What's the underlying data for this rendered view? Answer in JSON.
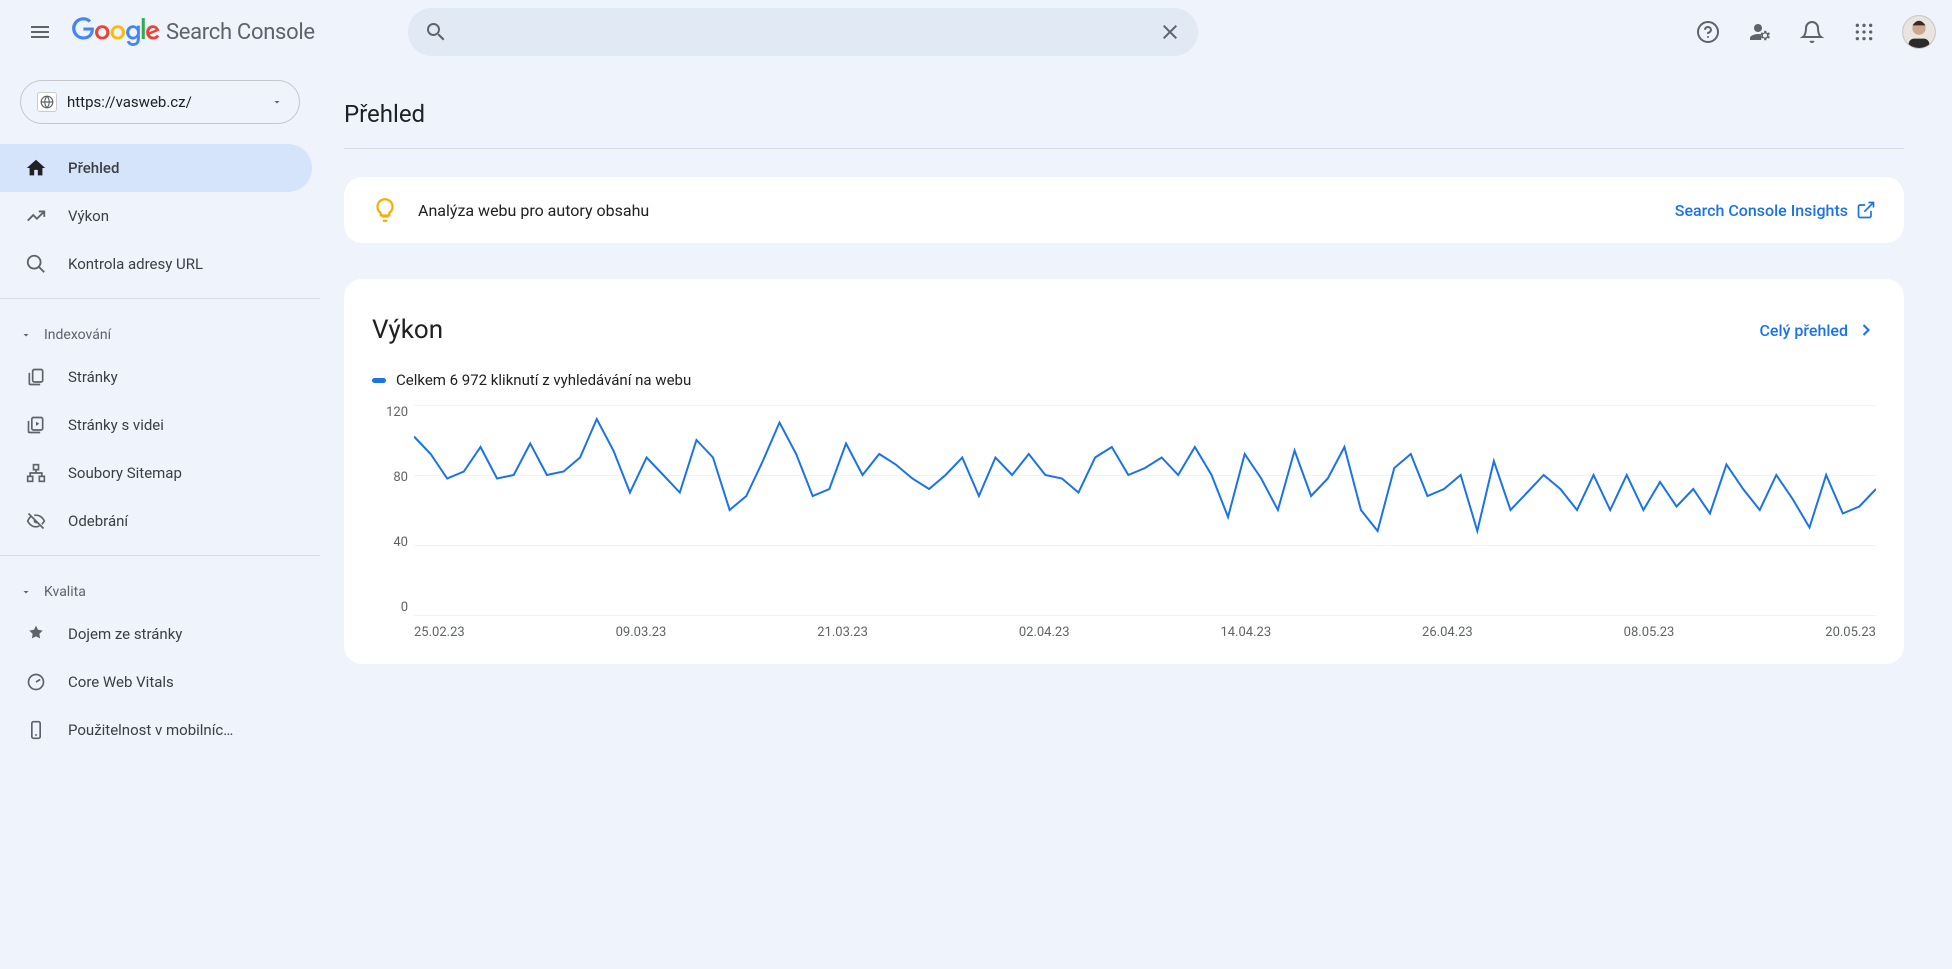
{
  "app_name": "Search Console",
  "header": {
    "search_placeholder": ""
  },
  "property": {
    "url": "https://vasweb.cz/"
  },
  "sidebar": {
    "primary": [
      {
        "id": "overview",
        "label": "Přehled"
      },
      {
        "id": "performance",
        "label": "Výkon"
      },
      {
        "id": "urlinspect",
        "label": "Kontrola adresy URL"
      }
    ],
    "sections": [
      {
        "id": "indexing",
        "label": "Indexování",
        "items": [
          {
            "id": "pages",
            "label": "Stránky"
          },
          {
            "id": "video-pages",
            "label": "Stránky s videi"
          },
          {
            "id": "sitemaps",
            "label": "Soubory Sitemap"
          },
          {
            "id": "removals",
            "label": "Odebrání"
          }
        ]
      },
      {
        "id": "quality",
        "label": "Kvalita",
        "items": [
          {
            "id": "page-experience",
            "label": "Dojem ze stránky"
          },
          {
            "id": "cwv",
            "label": "Core Web Vitals"
          },
          {
            "id": "mobile",
            "label": "Použitelnost v mobilníc…"
          }
        ]
      }
    ]
  },
  "page": {
    "title": "Přehled"
  },
  "insights_card": {
    "text": "Analýza webu pro autory obsahu",
    "link": "Search Console Insights"
  },
  "performance_card": {
    "title": "Výkon",
    "link": "Celý přehled",
    "legend": "Celkem 6 972 kliknutí z vyhledávání na webu"
  },
  "chart_data": {
    "type": "line",
    "title": "Výkon",
    "xlabel": "",
    "ylabel": "",
    "ylim": [
      0,
      120
    ],
    "y_ticks": [
      120,
      80,
      40,
      0
    ],
    "x_ticks": [
      "25.02.23",
      "09.03.23",
      "21.03.23",
      "02.04.23",
      "14.04.23",
      "26.04.23",
      "08.05.23",
      "20.05.23"
    ],
    "series": [
      {
        "name": "Celkem kliknutí",
        "color": "#1a73e8",
        "values": [
          102,
          92,
          78,
          82,
          96,
          78,
          80,
          98,
          80,
          82,
          90,
          112,
          94,
          70,
          90,
          80,
          70,
          100,
          90,
          60,
          68,
          88,
          110,
          92,
          68,
          72,
          98,
          80,
          92,
          86,
          78,
          72,
          80,
          90,
          68,
          90,
          80,
          92,
          80,
          78,
          70,
          90,
          96,
          80,
          84,
          90,
          80,
          96,
          80,
          56,
          92,
          78,
          60,
          94,
          68,
          78,
          96,
          60,
          48,
          84,
          92,
          68,
          72,
          80,
          48,
          88,
          60,
          70,
          80,
          72,
          60,
          80,
          60,
          80,
          60,
          76,
          62,
          72,
          58,
          86,
          72,
          60,
          80,
          66,
          50,
          80,
          58,
          62,
          72
        ]
      }
    ]
  }
}
